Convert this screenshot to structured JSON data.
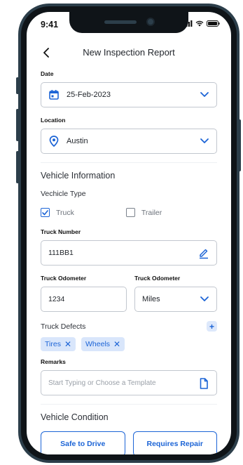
{
  "status_bar": {
    "time": "9:41"
  },
  "header": {
    "title": "New Inspection Report",
    "back_icon": "chevron-left-icon"
  },
  "form": {
    "date": {
      "label": "Date",
      "value": "25-Feb-2023",
      "icon": "calendar-icon"
    },
    "location": {
      "label": "Location",
      "value": "Austin",
      "icon": "location-pin-icon"
    },
    "vehicle_info": {
      "title": "Vehicle Information",
      "type_label": "Vechicle Type",
      "types": [
        {
          "label": "Truck",
          "checked": true
        },
        {
          "label": "Trailer",
          "checked": false
        }
      ]
    },
    "truck_number": {
      "label": "Truck Number",
      "value": "111BB1",
      "icon": "pencil-icon"
    },
    "odometer": {
      "value_label": "Truck Odometer",
      "value": "1234",
      "unit_label": "Truck Odometer",
      "unit": "Miles"
    },
    "defects": {
      "label": "Truck Defects",
      "add_label": "+",
      "items": [
        "Tires",
        "Wheels"
      ],
      "remove_glyph": "✕"
    },
    "remarks": {
      "label": "Remarks",
      "placeholder": "Start Typing or Choose a Template",
      "icon": "document-icon"
    },
    "condition": {
      "title": "Vehicle Condition",
      "options": [
        "Safe to Drive",
        "Requires Repair"
      ]
    }
  },
  "colors": {
    "accent": "#1c64d6",
    "chip_bg": "#d9e6fb",
    "border": "#c2c7cf",
    "frame": "#2c3e4a"
  }
}
